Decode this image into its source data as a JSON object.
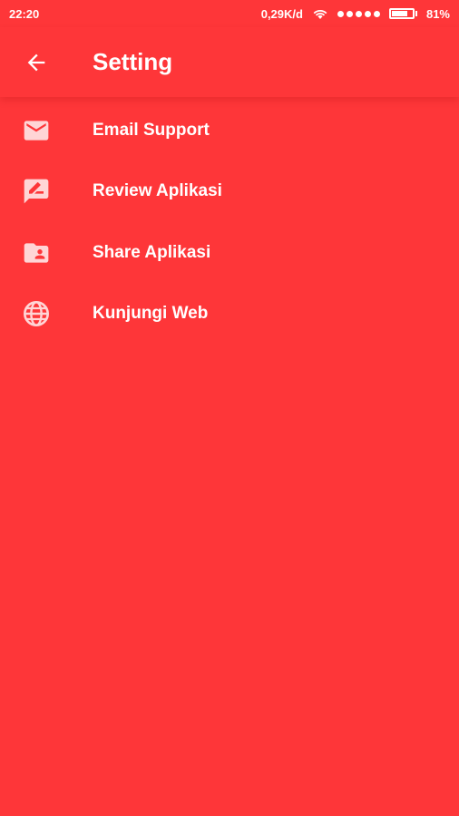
{
  "status_bar": {
    "time": "22:20",
    "network_speed": "0,29K/d",
    "battery_percent_label": "81%",
    "battery_level": 0.81,
    "icons": [
      "wifi-icon",
      "signal-icon",
      "battery-icon"
    ]
  },
  "app_bar": {
    "title": "Setting",
    "back_icon": "arrow-left-icon"
  },
  "menu": {
    "items": [
      {
        "label": "Email Support",
        "icon": "email-icon"
      },
      {
        "label": "Review Aplikasi",
        "icon": "rate-review-icon"
      },
      {
        "label": "Share Aplikasi",
        "icon": "shared-folder-icon"
      },
      {
        "label": "Kunjungi Web",
        "icon": "globe-icon"
      }
    ]
  },
  "colors": {
    "background": "#fe3639",
    "foreground": "#ffffff",
    "icon_tint": "#ffd5d6"
  }
}
